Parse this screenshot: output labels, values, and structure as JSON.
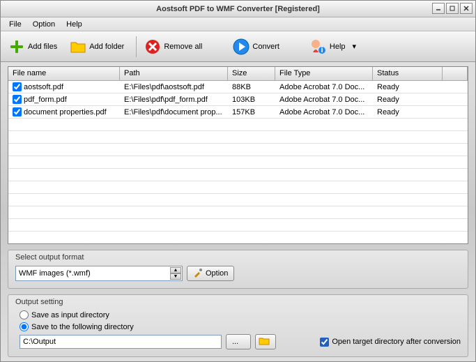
{
  "title": "Aostsoft PDF to WMF Converter [Registered]",
  "menu": {
    "file": "File",
    "option": "Option",
    "help": "Help"
  },
  "toolbar": {
    "add_files": "Add files",
    "add_folder": "Add folder",
    "remove_all": "Remove all",
    "convert": "Convert",
    "help": "Help"
  },
  "columns": {
    "filename": "File name",
    "path": "Path",
    "size": "Size",
    "filetype": "File Type",
    "status": "Status"
  },
  "rows": [
    {
      "checked": true,
      "name": "aostsoft.pdf",
      "path": "E:\\Files\\pdf\\aostsoft.pdf",
      "size": "88KB",
      "type": "Adobe Acrobat 7.0 Doc...",
      "status": "Ready"
    },
    {
      "checked": true,
      "name": "pdf_form.pdf",
      "path": "E:\\Files\\pdf\\pdf_form.pdf",
      "size": "103KB",
      "type": "Adobe Acrobat 7.0 Doc...",
      "status": "Ready"
    },
    {
      "checked": true,
      "name": "document properties.pdf",
      "path": "E:\\Files\\pdf\\document prop...",
      "size": "157KB",
      "type": "Adobe Acrobat 7.0 Doc...",
      "status": "Ready"
    }
  ],
  "format": {
    "label": "Select output format",
    "selected": "WMF images (*.wmf)",
    "option_btn": "Option"
  },
  "output": {
    "label": "Output setting",
    "save_as_input": "Save as input directory",
    "save_following": "Save to the following directory",
    "path": "C:\\Output",
    "browse": "...",
    "open_target": "Open target directory after conversion"
  }
}
